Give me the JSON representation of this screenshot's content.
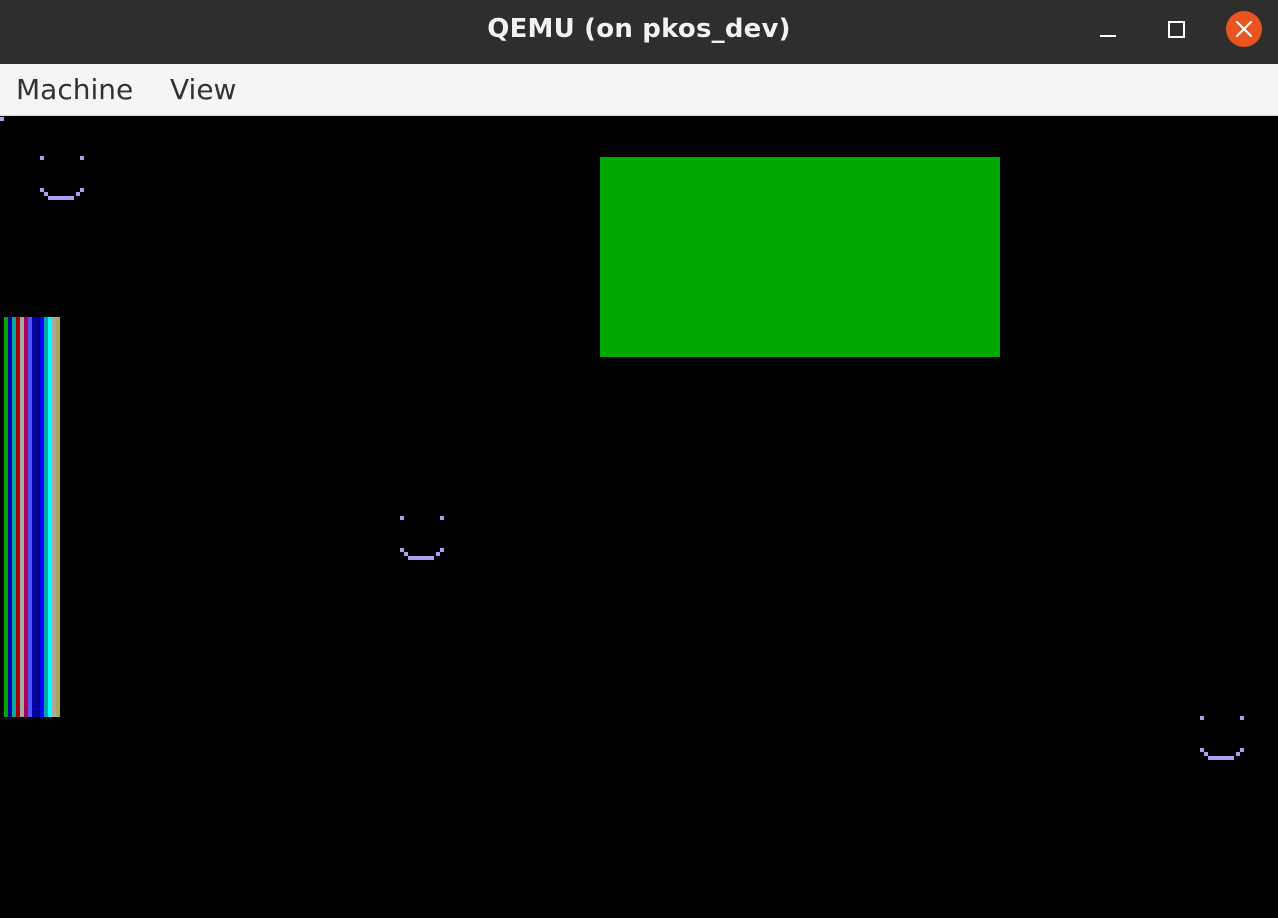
{
  "window": {
    "title": "QEMU (on pkos_dev)"
  },
  "menubar": {
    "items": [
      {
        "label": "Machine"
      },
      {
        "label": "View"
      }
    ]
  },
  "screen": {
    "background": "#000000",
    "smiley_color": "#a8a0f0",
    "rect_color": "#00a800",
    "stripe_colors": [
      "#00a800",
      "#0000a8",
      "#a80054",
      "#a8a8a8",
      "#0000ff",
      "#00a8a8",
      "#5454ff",
      "#a8a854"
    ]
  },
  "colors": {
    "titlebar": "#2f2e2c",
    "menubar": "#f6f5f4",
    "close_button": "#e95420"
  }
}
